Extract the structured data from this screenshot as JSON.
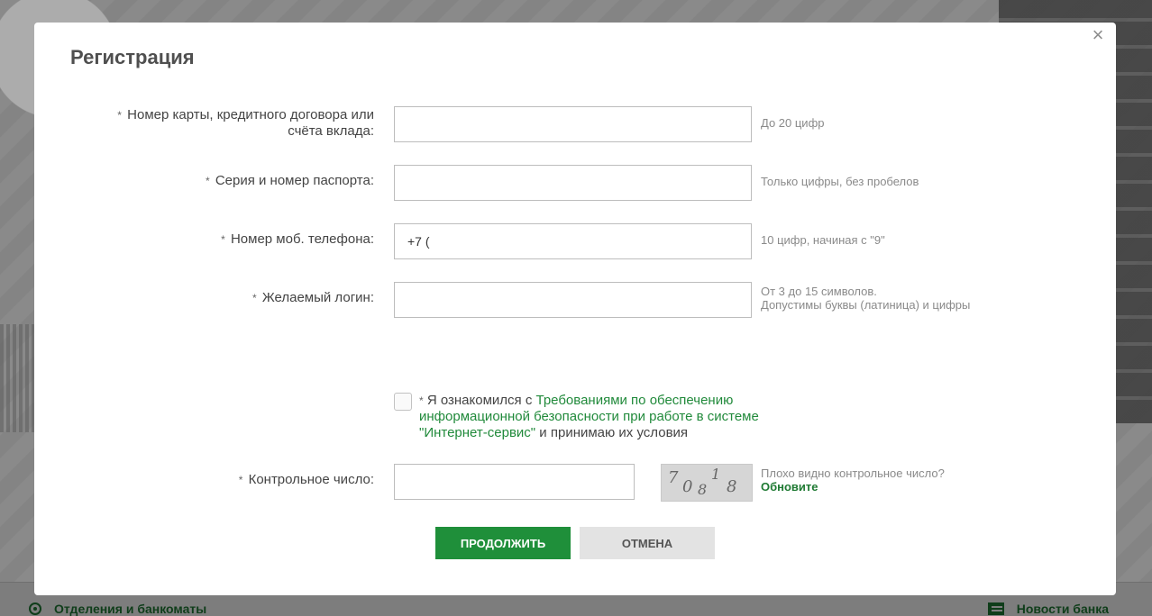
{
  "background": {
    "links": {
      "branches": "Отделения и банкоматы",
      "news": "Новости банка"
    }
  },
  "modal": {
    "title": "Регистрация",
    "close_icon": "close-icon",
    "required_mark": "*",
    "fields": {
      "card": {
        "label": "Номер карты, кредитного договора или счёта вклада:",
        "value": "",
        "hint": "До 20 цифр"
      },
      "passport": {
        "label": "Серия и номер паспорта:",
        "value": "",
        "hint": "Только цифры, без пробелов"
      },
      "phone": {
        "label": "Номер моб. телефона:",
        "value": "+7 (",
        "hint": "10 цифр, начиная с \"9\""
      },
      "login": {
        "label": "Желаемый логин:",
        "value": "",
        "hint_line1": "От 3 до 15 символов.",
        "hint_line2": "Допустимы буквы (латиница) и цифры"
      }
    },
    "agreement": {
      "prefix": "Я ознакомился с ",
      "link": "Требованиями по обеспечению информационной безопасности при работе в системе \"Интернет-сервис\"",
      "suffix": " и принимаю их условия",
      "checked": false
    },
    "captcha": {
      "label": "Контрольное число:",
      "value": "",
      "digits": [
        "7",
        "0",
        "8",
        "1",
        "8"
      ],
      "hint": "Плохо видно контрольное число?",
      "refresh": "Обновите"
    },
    "buttons": {
      "continue": "Продолжить",
      "cancel": "Отмена"
    },
    "colors": {
      "accent": "#1f8f3a",
      "link": "#218a3b",
      "cancel_bg": "#e3e3e3"
    }
  }
}
